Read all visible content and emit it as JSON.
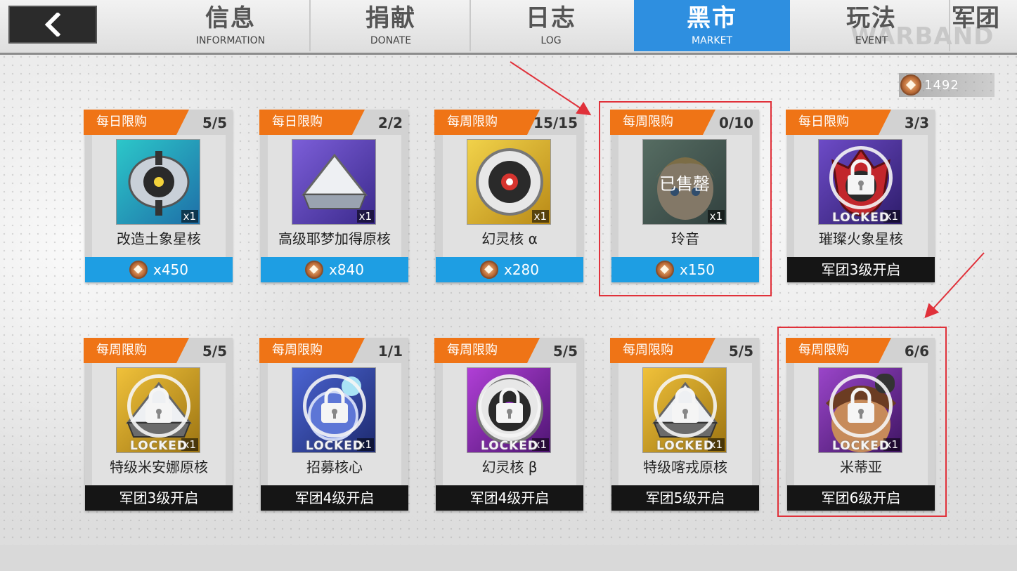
{
  "colors": {
    "tab_active": "#2e8fe0",
    "tag_orange": "#ef7416",
    "price_blue": "#1e9ee3",
    "lock_bar": "#151515",
    "annotation_red": "#e0313a"
  },
  "topbar": {
    "back_icon": "chevron-left-icon",
    "tabs": [
      {
        "zh": "信息",
        "en": "INFORMATION"
      },
      {
        "zh": "捐献",
        "en": "DONATE"
      },
      {
        "zh": "日志",
        "en": "LOG"
      },
      {
        "zh": "黑市",
        "en": "MARKET",
        "active": true
      },
      {
        "zh": "玩法",
        "en": "EVENT"
      },
      {
        "zh": "军团",
        "en": ""
      }
    ],
    "watermark": "WARBAND"
  },
  "currency": {
    "icon": "coin-icon",
    "value": "1492"
  },
  "cards": [
    {
      "tag": "每日限购",
      "count": "5/5",
      "name": "改造土象星核",
      "qty": "x1",
      "price": "x450"
    },
    {
      "tag": "每日限购",
      "count": "2/2",
      "name": "高级耶梦加得原核",
      "qty": "x1",
      "price": "x840"
    },
    {
      "tag": "每周限购",
      "count": "15/15",
      "name": "幻灵核 α",
      "qty": "x1",
      "price": "x280"
    },
    {
      "tag": "每周限购",
      "count": "0/10",
      "name": "玲音",
      "qty": "x1",
      "price": "x150",
      "sold": "已售罄"
    },
    {
      "tag": "每日限购",
      "count": "3/3",
      "name": "璀璨火象星核",
      "qty": "x1",
      "lock": "军团3级开启",
      "locked": "LOCKED"
    },
    {
      "tag": "每周限购",
      "count": "5/5",
      "name": "特级米安娜原核",
      "qty": "x1",
      "lock": "军团3级开启",
      "locked": "LOCKED"
    },
    {
      "tag": "每周限购",
      "count": "1/1",
      "name": "招募核心",
      "qty": "x1",
      "lock": "军团4级开启",
      "locked": "LOCKED"
    },
    {
      "tag": "每周限购",
      "count": "5/5",
      "name": "幻灵核 β",
      "qty": "x1",
      "lock": "军团4级开启",
      "locked": "LOCKED"
    },
    {
      "tag": "每周限购",
      "count": "5/5",
      "name": "特级喀戎原核",
      "qty": "x1",
      "lock": "军团5级开启",
      "locked": "LOCKED"
    },
    {
      "tag": "每周限购",
      "count": "6/6",
      "name": "米蒂亚",
      "qty": "x1",
      "lock": "军团6级开启",
      "locked": "LOCKED"
    }
  ]
}
